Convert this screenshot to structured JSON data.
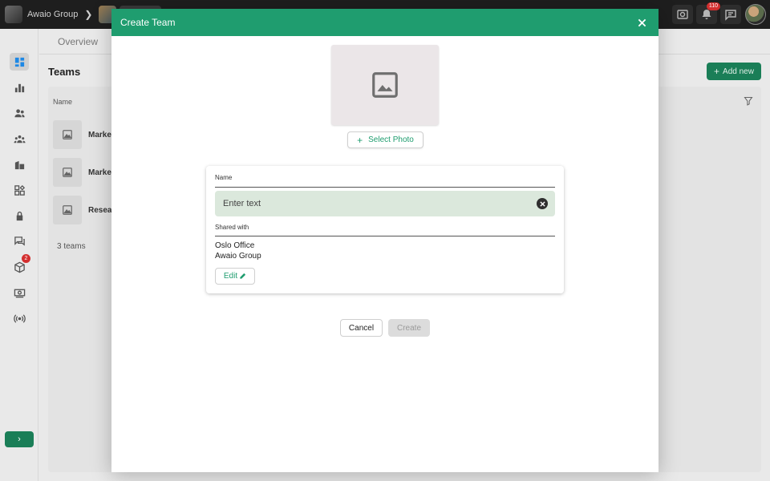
{
  "topbar": {
    "org_name": "Awaio Group",
    "notifications_count": "110"
  },
  "tabs": {
    "overview": "Overview"
  },
  "page": {
    "title": "Teams",
    "add_new_label": "Add new",
    "column_name": "Name",
    "teams": [
      {
        "name": "Marke"
      },
      {
        "name": "Marke"
      },
      {
        "name": "Resea"
      }
    ],
    "teams_count": "3 teams"
  },
  "sidebar": {
    "items": [
      {
        "icon": "dashboard-icon",
        "active": true
      },
      {
        "icon": "bar-chart-icon"
      },
      {
        "icon": "users-icon"
      },
      {
        "icon": "groups-icon"
      },
      {
        "icon": "buildings-icon"
      },
      {
        "icon": "apps-icon"
      },
      {
        "icon": "lock-icon"
      },
      {
        "icon": "chat-icon"
      },
      {
        "icon": "package-icon",
        "badge": "2"
      },
      {
        "icon": "money-icon"
      },
      {
        "icon": "broadcast-icon"
      }
    ],
    "expand_label": "›"
  },
  "modal": {
    "title": "Create Team",
    "select_photo_label": "Select Photo",
    "name_label": "Name",
    "name_placeholder": "Enter text",
    "shared_with_label": "Shared with",
    "shared_with": [
      "Oslo Office",
      "Awaio Group"
    ],
    "edit_label": "Edit",
    "cancel_label": "Cancel",
    "create_label": "Create"
  },
  "colors": {
    "accent": "#1f9d6f",
    "primary_dark": "#1a7e57",
    "input_bg": "#dbe8dc"
  }
}
